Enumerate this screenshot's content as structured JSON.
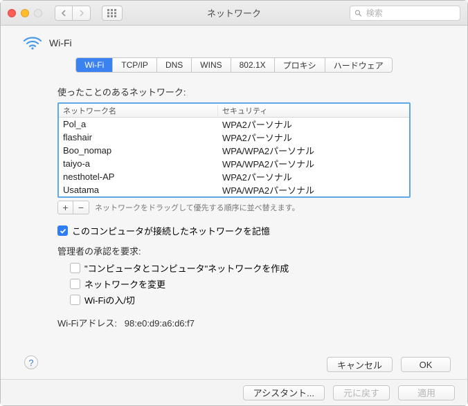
{
  "window": {
    "title": "ネットワーク"
  },
  "search": {
    "placeholder": "検索"
  },
  "heading": {
    "label": "Wi-Fi"
  },
  "tabs": {
    "items": [
      {
        "label": "Wi-Fi",
        "active": true
      },
      {
        "label": "TCP/IP"
      },
      {
        "label": "DNS"
      },
      {
        "label": "WINS"
      },
      {
        "label": "802.1X"
      },
      {
        "label": "プロキシ"
      },
      {
        "label": "ハードウェア"
      }
    ]
  },
  "networks": {
    "panel_label": "使ったことのあるネットワーク:",
    "col_name": "ネットワーク名",
    "col_security": "セキュリティ",
    "rows": [
      {
        "name": "Pol_a",
        "security": "WPA2パーソナル"
      },
      {
        "name": "flashair",
        "security": "WPA2パーソナル"
      },
      {
        "name": "Boo_nomap",
        "security": "WPA/WPA2パーソナル"
      },
      {
        "name": "taiyo-a",
        "security": "WPA/WPA2パーソナル"
      },
      {
        "name": "nesthotel-AP",
        "security": "WPA2パーソナル"
      },
      {
        "name": "Usatama",
        "security": "WPA/WPA2パーソナル"
      }
    ],
    "hint": "ネットワークをドラッグして優先する順序に並べ替えます。"
  },
  "remember": {
    "checked": true,
    "label": "このコンピュータが接続したネットワークを記憶"
  },
  "admin": {
    "label": "管理者の承認を要求:",
    "options": [
      {
        "label": "\"コンピュータとコンピュータ\"ネットワークを作成",
        "checked": false
      },
      {
        "label": "ネットワークを変更",
        "checked": false
      },
      {
        "label": "Wi-Fiの入/切",
        "checked": false
      }
    ]
  },
  "address": {
    "label": "Wi-Fiアドレス:",
    "value": "98:e0:d9:a6:d6:f7"
  },
  "buttons": {
    "cancel": "キャンセル",
    "ok": "OK",
    "assistant": "アシスタント...",
    "revert": "元に戻す",
    "apply": "適用",
    "plus": "+",
    "minus": "−",
    "help": "?"
  }
}
